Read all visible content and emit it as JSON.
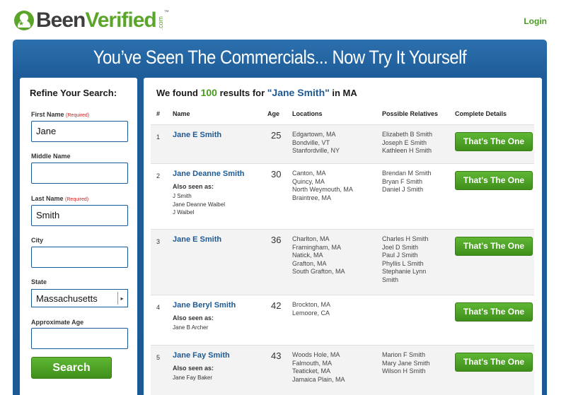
{
  "header": {
    "logo": {
      "been": "Been",
      "verified": "Verified",
      "com": ".com",
      "tm": "™"
    },
    "login": "Login"
  },
  "banner": {
    "title": "You’ve Seen The Commercials... Now Try It Yourself"
  },
  "sidebar": {
    "title": "Refine Your Search:",
    "required": "(Required)",
    "first_name": {
      "label": "First Name",
      "value": "Jane"
    },
    "middle_name": {
      "label": "Middle Name",
      "value": ""
    },
    "last_name": {
      "label": "Last Name",
      "value": "Smith"
    },
    "city": {
      "label": "City",
      "value": ""
    },
    "state": {
      "label": "State",
      "value": "Massachusetts"
    },
    "age": {
      "label": "Approximate Age",
      "value": ""
    },
    "search_label": "Search"
  },
  "results": {
    "heading_pre": "We found",
    "count": "100",
    "heading_mid": "results for",
    "query": "\"Jane Smith\"",
    "heading_post": "in MA",
    "columns": {
      "num": "#",
      "name": "Name",
      "age": "Age",
      "locations": "Locations",
      "relatives": "Possible Relatives",
      "details": "Complete Details"
    },
    "also_seen_label": "Also seen as:",
    "button_label": "That's The One",
    "rows": [
      {
        "num": "1",
        "name": "Jane E Smith",
        "age": "25",
        "aliases": [],
        "locations": [
          "Edgartown, MA",
          "Bondville, VT",
          "Stanfordville, NY"
        ],
        "relatives": [
          "Elizabeth B Smith",
          "Joseph E Smith",
          "Kathleen H Smith"
        ]
      },
      {
        "num": "2",
        "name": "Jane Deanne Smith",
        "age": "30",
        "aliases": [
          "J Smith",
          "Jane Deanne Waibel",
          "J Waibel"
        ],
        "locations": [
          "Canton, MA",
          "Quincy, MA",
          "North Weymouth, MA",
          "Braintree, MA"
        ],
        "relatives": [
          "Brendan M Smith",
          "Bryan F Smith",
          "Daniel J Smith"
        ]
      },
      {
        "num": "3",
        "name": "Jane E Smith",
        "age": "36",
        "aliases": [],
        "locations": [
          "Charlton, MA",
          "Framingham, MA",
          "Natick, MA",
          "Grafton, MA",
          "South Grafton, MA"
        ],
        "relatives": [
          "Charles H Smith",
          "Joel D Smith",
          "Paul J Smith",
          "Phyllis L Smith",
          "Stephanie Lynn",
          "Smith"
        ]
      },
      {
        "num": "4",
        "name": "Jane Beryl Smith",
        "age": "42",
        "aliases": [
          "Jane B Archer"
        ],
        "locations": [
          "Brockton, MA",
          "Lemoore, CA"
        ],
        "relatives": []
      },
      {
        "num": "5",
        "name": "Jane Fay Smith",
        "age": "43",
        "aliases": [
          "Jane Fay Baker"
        ],
        "locations": [
          "Woods Hole, MA",
          "Falmouth, MA",
          "Teaticket, MA",
          "Jamaica Plain, MA"
        ],
        "relatives": [
          "Marion F Smith",
          "Mary Jane Smith",
          "Wilson H Smith"
        ]
      }
    ]
  }
}
